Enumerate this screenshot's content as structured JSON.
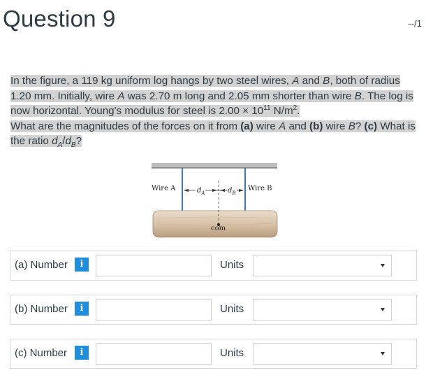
{
  "header": {
    "title": "Question 9",
    "points": "--/1"
  },
  "question": {
    "line1": "In the figure, a 119 kg uniform log hangs by two steel wires, ",
    "A": "A",
    "and": " and ",
    "B": "B",
    "line1b": ", both of radius 1.20 mm. Initially, wire ",
    "A2": "A",
    "line1c": " was 2.70 m long and 2.05 mm shorter than wire ",
    "B2": "B",
    "line1d": ". The log is now horizontal. Young's modulus for steel is 2.00 × 10",
    "exp": "11",
    "line1e": " N/m",
    "sq": "2",
    "line1f": ".",
    "line2a": "What are the magnitudes of the forces on it from ",
    "pa": "(a)",
    "line2b": " wire ",
    "A3": "A",
    "and2": " and ",
    "pb": "(b)",
    "line2c": " wire ",
    "B3": "B",
    "line2d": "? ",
    "pc": "(c)",
    "line2e": " What is the ratio ",
    "d1": "d",
    "d1sub": "A",
    "slash": "/",
    "d2": "d",
    "d2sub": "B",
    "q": "?"
  },
  "figure": {
    "wire_a_label": "Wire A",
    "wire_b_label": "Wire B",
    "da_label": "d",
    "da_sub": "A",
    "db_label": "d",
    "db_sub": "B",
    "com_label": "com"
  },
  "answers": [
    {
      "part": "(a)",
      "label": "Number",
      "info": "i",
      "value": "",
      "units_label": "Units",
      "units_value": ""
    },
    {
      "part": "(b)",
      "label": "Number",
      "info": "i",
      "value": "",
      "units_label": "Units",
      "units_value": ""
    },
    {
      "part": "(c)",
      "label": "Number",
      "info": "i",
      "value": "",
      "units_label": "Units",
      "units_value": ""
    }
  ],
  "colors": {
    "info_button": "#1d8ee0",
    "highlight": "#d2d2d2",
    "wire": "#3a7ab8",
    "log": "#d9c6ad"
  }
}
